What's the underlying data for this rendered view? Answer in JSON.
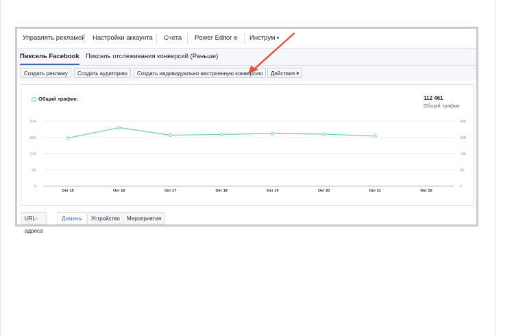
{
  "top_nav": {
    "items": [
      "Управлять рекламой",
      "Настройки аккаунта",
      "Счета",
      "Power Editor",
      "Инструм"
    ]
  },
  "sub_tabs": [
    "Пиксель Facebook",
    "Пиксель отслеживания конверсий (Раньше)"
  ],
  "toolbar": {
    "buttons": [
      "Создать рекламу",
      "Создать аудиторию",
      "Создать индивидуально настроенную конверсию"
    ],
    "actions_label": "Действия"
  },
  "chart_card": {
    "legend": "Общий трафик:",
    "total_value": "112 461",
    "total_label": "Общий трафик:"
  },
  "bottom_tabs": [
    "URL-адреса",
    "Домены",
    "Устройство",
    "Мероприятия"
  ],
  "colors": {
    "line": "#6fcfb0",
    "link": "#4267b2",
    "arrow": "#d9573b"
  },
  "chart_data": {
    "type": "line",
    "x": [
      "Окт 15",
      "Окт 16",
      "Окт 17",
      "Окт 18",
      "Окт 19",
      "Окт 20",
      "Окт 21",
      "Окт 22"
    ],
    "series": [
      {
        "values": [
          14800,
          18000,
          15700,
          15900,
          16200,
          16000,
          15400
        ]
      }
    ],
    "yticks": [
      "0",
      "5K",
      "10K",
      "15K",
      "20K"
    ],
    "ylim": [
      0,
      20000
    ],
    "grid": true
  }
}
